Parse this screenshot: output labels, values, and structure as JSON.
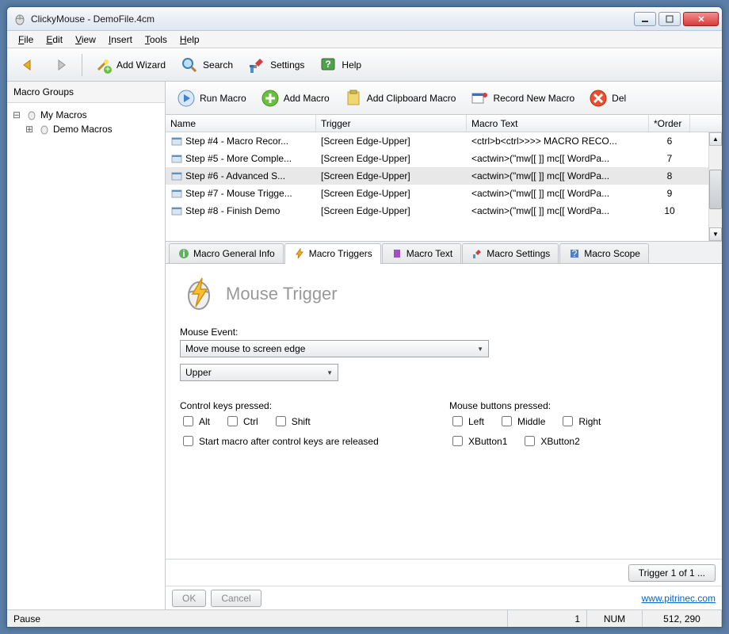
{
  "window": {
    "title": "ClickyMouse - DemoFile.4cm"
  },
  "menu": {
    "file": "File",
    "edit": "Edit",
    "view": "View",
    "insert": "Insert",
    "tools": "Tools",
    "help": "Help"
  },
  "toolbar": {
    "add_wizard": "Add Wizard",
    "search": "Search",
    "settings": "Settings",
    "help": "Help"
  },
  "sidebar": {
    "title": "Macro Groups",
    "root": "My Macros",
    "child": "Demo Macros"
  },
  "toolbar2": {
    "run": "Run Macro",
    "add": "Add Macro",
    "clipboard": "Add Clipboard Macro",
    "record": "Record New Macro",
    "delete": "Del"
  },
  "list": {
    "cols": {
      "name": "Name",
      "trigger": "Trigger",
      "text": "Macro Text",
      "order": "*Order"
    },
    "rows": [
      {
        "name": "Step #4 - Macro Recor...",
        "trigger": "[Screen Edge-Upper]",
        "text": "<ctrl>b<ctrl>>>> MACRO RECO...",
        "order": "6",
        "sel": false
      },
      {
        "name": "Step #5 - More Comple...",
        "trigger": "[Screen Edge-Upper]",
        "text": "<actwin>(\"mw[[  ]] mc[[ WordPa...",
        "order": "7",
        "sel": false
      },
      {
        "name": "Step #6 - Advanced S...",
        "trigger": "[Screen Edge-Upper]",
        "text": "<actwin>(\"mw[[  ]] mc[[ WordPa...",
        "order": "8",
        "sel": true
      },
      {
        "name": "Step #7 - Mouse Trigge...",
        "trigger": "[Screen Edge-Upper]",
        "text": "<actwin>(\"mw[[  ]] mc[[ WordPa...",
        "order": "9",
        "sel": false
      },
      {
        "name": "Step #8 - Finish Demo",
        "trigger": "[Screen Edge-Upper]",
        "text": "<actwin>(\"mw[[  ]] mc[[ WordPa...",
        "order": "10",
        "sel": false
      }
    ]
  },
  "tabs": {
    "general": "Macro General Info",
    "triggers": "Macro Triggers",
    "text": "Macro Text",
    "settings": "Macro Settings",
    "scope": "Macro Scope"
  },
  "page": {
    "title": "Mouse Trigger",
    "event_label": "Mouse Event:",
    "event_value": "Move mouse to screen edge",
    "edge_value": "Upper",
    "ctrl_label": "Control keys pressed:",
    "alt": "Alt",
    "ctrl": "Ctrl",
    "shift": "Shift",
    "start_after": "Start macro after control keys are released",
    "mouse_label": "Mouse buttons pressed:",
    "left": "Left",
    "middle": "Middle",
    "right": "Right",
    "x1": "XButton1",
    "x2": "XButton2",
    "trigger_btn": "Trigger 1 of 1 ...",
    "ok": "OK",
    "cancel": "Cancel",
    "link": "www.pitrinec.com"
  },
  "status": {
    "pause": "Pause",
    "one": "1",
    "num": "NUM",
    "coords": "512, 290"
  }
}
